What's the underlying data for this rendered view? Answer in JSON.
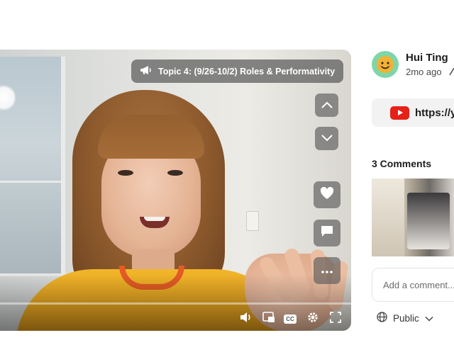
{
  "video": {
    "topic_label": "Topic 4: (9/26-10/2) Roles & Performativity",
    "progress_fraction": 0.0,
    "side_controls": [
      "chevron-up-icon",
      "chevron-down-icon",
      "heart-icon",
      "comment-icon",
      "more-icon"
    ],
    "bottom_controls": [
      "volume-icon",
      "picture-in-picture-icon",
      "closed-captions-icon",
      "settings-icon",
      "fullscreen-icon"
    ],
    "cc_label": "CC"
  },
  "post": {
    "author": "Hui Ting",
    "posted": "2mo ago",
    "link_text": "https://y"
  },
  "comments": {
    "title": "3 Comments",
    "input_placeholder": "Add a comment..."
  },
  "visibility": {
    "label": "Public"
  },
  "colors": {
    "accent_red": "#e62117",
    "avatar_bg": "#7fd6a8",
    "control_bg": "rgba(90,90,90,0.7)"
  }
}
